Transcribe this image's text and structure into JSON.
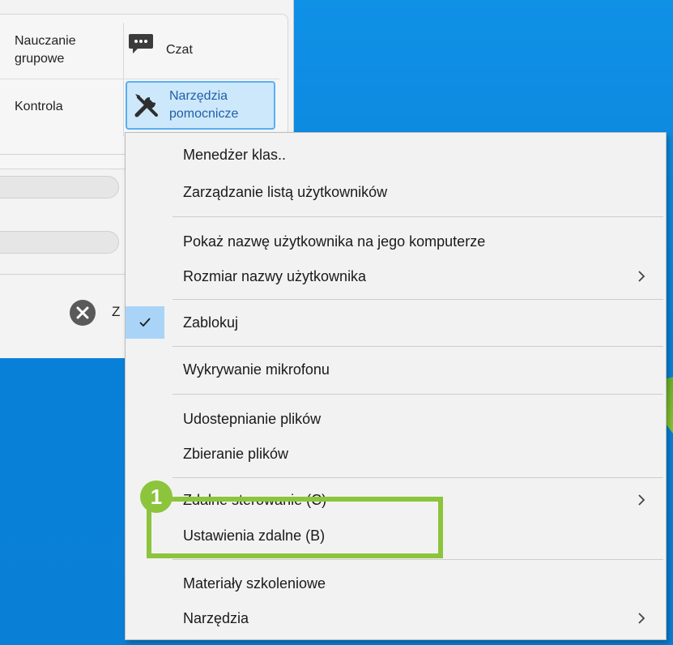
{
  "ribbon": {
    "nauczanie_line1": "Nauczanie",
    "nauczanie_line2": "grupowe",
    "czat": "Czat",
    "kontrola": "Kontrola",
    "narzedzia_line1": "Narzędzia",
    "narzedzia_line2": "pomocnicze"
  },
  "app": {
    "close_label_partial": "Z"
  },
  "menu": {
    "items": [
      {
        "label": "Menedżer klas.."
      },
      {
        "label": "Zarządzanie listą użytkowników"
      },
      {
        "label": "Pokaż nazwę użytkownika na jego komputerze"
      },
      {
        "label": "Rozmiar nazwy użytkownika",
        "submenu": true
      },
      {
        "label": "Zablokuj",
        "checked": true
      },
      {
        "label": "Wykrywanie mikrofonu"
      },
      {
        "label": "Udostepnianie plików"
      },
      {
        "label": "Zbieranie plików"
      },
      {
        "label": "Zdalne sterowanie (C)",
        "submenu": true
      },
      {
        "label": "Ustawienia zdalne (B)",
        "highlighted": true
      },
      {
        "label": "Materiały szkoleniowe"
      },
      {
        "label": "Narzędzia",
        "submenu": true
      }
    ]
  },
  "annotation": {
    "badge_number": "1",
    "color": "#8cc43c"
  },
  "colors": {
    "desktop": "#0a86dc",
    "selected_button": "#cde8fb",
    "check_bg": "#a9d4f7"
  },
  "icons": [
    "chat-icon",
    "tools-icon",
    "close-icon",
    "check-icon",
    "chevron-right-icon"
  ]
}
